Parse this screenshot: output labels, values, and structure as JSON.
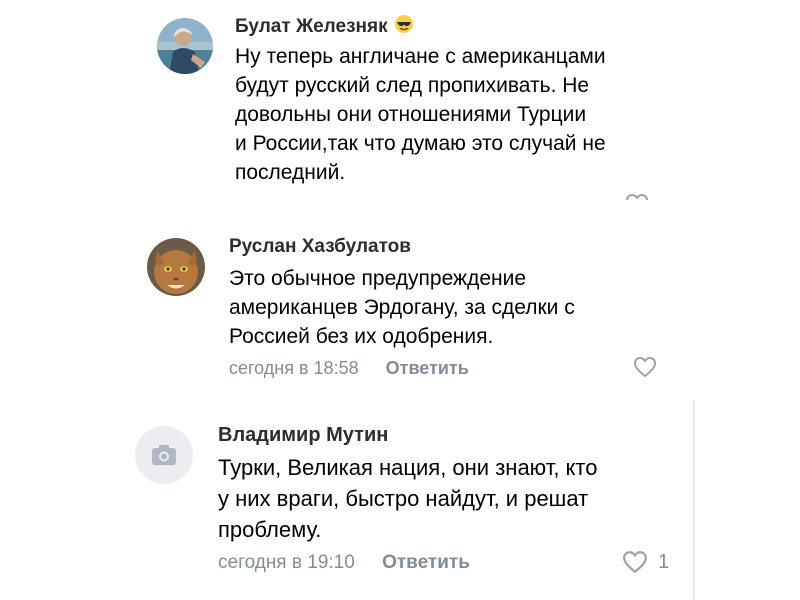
{
  "comments": [
    {
      "author": "Булат Железняк",
      "author_emoji_icon": "sunglasses-emoji-icon",
      "lines": [
        "Ну теперь англичане с американцами",
        "будут русский след пропихивать. Не",
        "довольны они отношениями Турции",
        "и России,так что думаю это случай не",
        "последний."
      ],
      "avatar_icon": "user-photo-avatar"
    },
    {
      "author": "Руслан Хазбулатов",
      "lines": [
        "Это обычное предупреждение",
        "американцев Эрдогану, за сделки с",
        "Россией без их одобрения."
      ],
      "time": "сегодня в 18:58",
      "reply_label": "Ответить",
      "avatar_icon": "cat-photo-avatar",
      "like_icon": "heart-outline-icon"
    },
    {
      "author": "Владимир Мутин",
      "lines": [
        "Турки, Великая нация, они знают, кто",
        "у них враги, быстро найдут, и решат",
        "проблему."
      ],
      "time": "сегодня в 19:10",
      "reply_label": "Ответить",
      "avatar_icon": "camera-placeholder-avatar",
      "like_icon": "heart-outline-icon",
      "like_count": "1"
    }
  ],
  "colors": {
    "secondary_text": "#818c99",
    "icon_gray": "#99a2ad",
    "placeholder_bg": "#ebedf0"
  }
}
